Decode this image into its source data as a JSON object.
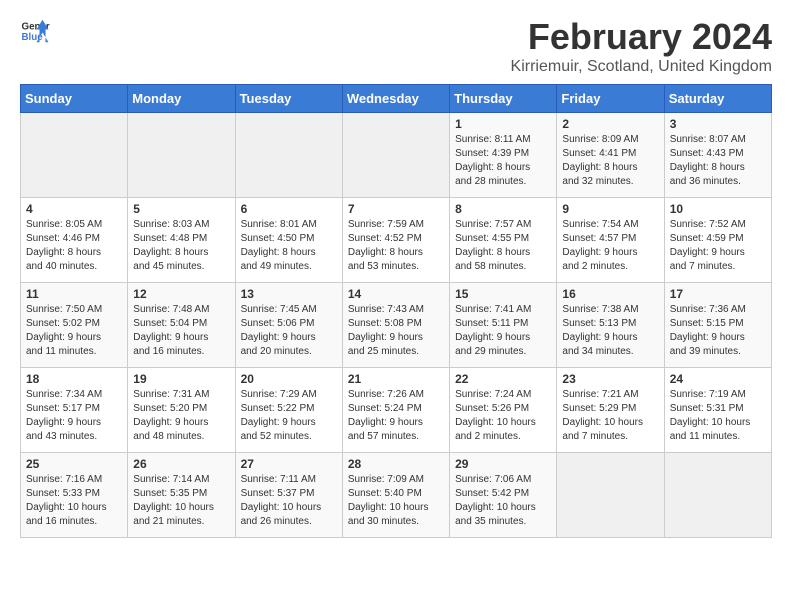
{
  "logo": {
    "general": "General",
    "blue": "Blue"
  },
  "title": "February 2024",
  "location": "Kirriemuir, Scotland, United Kingdom",
  "headers": [
    "Sunday",
    "Monday",
    "Tuesday",
    "Wednesday",
    "Thursday",
    "Friday",
    "Saturday"
  ],
  "weeks": [
    [
      {
        "day": "",
        "info": ""
      },
      {
        "day": "",
        "info": ""
      },
      {
        "day": "",
        "info": ""
      },
      {
        "day": "",
        "info": ""
      },
      {
        "day": "1",
        "info": "Sunrise: 8:11 AM\nSunset: 4:39 PM\nDaylight: 8 hours\nand 28 minutes."
      },
      {
        "day": "2",
        "info": "Sunrise: 8:09 AM\nSunset: 4:41 PM\nDaylight: 8 hours\nand 32 minutes."
      },
      {
        "day": "3",
        "info": "Sunrise: 8:07 AM\nSunset: 4:43 PM\nDaylight: 8 hours\nand 36 minutes."
      }
    ],
    [
      {
        "day": "4",
        "info": "Sunrise: 8:05 AM\nSunset: 4:46 PM\nDaylight: 8 hours\nand 40 minutes."
      },
      {
        "day": "5",
        "info": "Sunrise: 8:03 AM\nSunset: 4:48 PM\nDaylight: 8 hours\nand 45 minutes."
      },
      {
        "day": "6",
        "info": "Sunrise: 8:01 AM\nSunset: 4:50 PM\nDaylight: 8 hours\nand 49 minutes."
      },
      {
        "day": "7",
        "info": "Sunrise: 7:59 AM\nSunset: 4:52 PM\nDaylight: 8 hours\nand 53 minutes."
      },
      {
        "day": "8",
        "info": "Sunrise: 7:57 AM\nSunset: 4:55 PM\nDaylight: 8 hours\nand 58 minutes."
      },
      {
        "day": "9",
        "info": "Sunrise: 7:54 AM\nSunset: 4:57 PM\nDaylight: 9 hours\nand 2 minutes."
      },
      {
        "day": "10",
        "info": "Sunrise: 7:52 AM\nSunset: 4:59 PM\nDaylight: 9 hours\nand 7 minutes."
      }
    ],
    [
      {
        "day": "11",
        "info": "Sunrise: 7:50 AM\nSunset: 5:02 PM\nDaylight: 9 hours\nand 11 minutes."
      },
      {
        "day": "12",
        "info": "Sunrise: 7:48 AM\nSunset: 5:04 PM\nDaylight: 9 hours\nand 16 minutes."
      },
      {
        "day": "13",
        "info": "Sunrise: 7:45 AM\nSunset: 5:06 PM\nDaylight: 9 hours\nand 20 minutes."
      },
      {
        "day": "14",
        "info": "Sunrise: 7:43 AM\nSunset: 5:08 PM\nDaylight: 9 hours\nand 25 minutes."
      },
      {
        "day": "15",
        "info": "Sunrise: 7:41 AM\nSunset: 5:11 PM\nDaylight: 9 hours\nand 29 minutes."
      },
      {
        "day": "16",
        "info": "Sunrise: 7:38 AM\nSunset: 5:13 PM\nDaylight: 9 hours\nand 34 minutes."
      },
      {
        "day": "17",
        "info": "Sunrise: 7:36 AM\nSunset: 5:15 PM\nDaylight: 9 hours\nand 39 minutes."
      }
    ],
    [
      {
        "day": "18",
        "info": "Sunrise: 7:34 AM\nSunset: 5:17 PM\nDaylight: 9 hours\nand 43 minutes."
      },
      {
        "day": "19",
        "info": "Sunrise: 7:31 AM\nSunset: 5:20 PM\nDaylight: 9 hours\nand 48 minutes."
      },
      {
        "day": "20",
        "info": "Sunrise: 7:29 AM\nSunset: 5:22 PM\nDaylight: 9 hours\nand 52 minutes."
      },
      {
        "day": "21",
        "info": "Sunrise: 7:26 AM\nSunset: 5:24 PM\nDaylight: 9 hours\nand 57 minutes."
      },
      {
        "day": "22",
        "info": "Sunrise: 7:24 AM\nSunset: 5:26 PM\nDaylight: 10 hours\nand 2 minutes."
      },
      {
        "day": "23",
        "info": "Sunrise: 7:21 AM\nSunset: 5:29 PM\nDaylight: 10 hours\nand 7 minutes."
      },
      {
        "day": "24",
        "info": "Sunrise: 7:19 AM\nSunset: 5:31 PM\nDaylight: 10 hours\nand 11 minutes."
      }
    ],
    [
      {
        "day": "25",
        "info": "Sunrise: 7:16 AM\nSunset: 5:33 PM\nDaylight: 10 hours\nand 16 minutes."
      },
      {
        "day": "26",
        "info": "Sunrise: 7:14 AM\nSunset: 5:35 PM\nDaylight: 10 hours\nand 21 minutes."
      },
      {
        "day": "27",
        "info": "Sunrise: 7:11 AM\nSunset: 5:37 PM\nDaylight: 10 hours\nand 26 minutes."
      },
      {
        "day": "28",
        "info": "Sunrise: 7:09 AM\nSunset: 5:40 PM\nDaylight: 10 hours\nand 30 minutes."
      },
      {
        "day": "29",
        "info": "Sunrise: 7:06 AM\nSunset: 5:42 PM\nDaylight: 10 hours\nand 35 minutes."
      },
      {
        "day": "",
        "info": ""
      },
      {
        "day": "",
        "info": ""
      }
    ]
  ]
}
